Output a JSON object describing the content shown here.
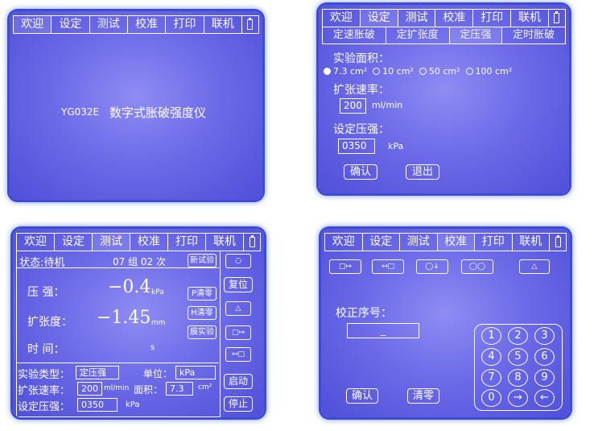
{
  "tabs": [
    "欢迎",
    "设定",
    "测试",
    "校准",
    "打印",
    "联机"
  ],
  "welcome": {
    "model": "YG032E",
    "title": "数字式胀破强度仪"
  },
  "settings": {
    "subtabs": [
      "定速胀破",
      "定扩张度",
      "定压强",
      "定时胀破"
    ],
    "area_label": "实验面积：",
    "areas": [
      "7.3 cm²",
      "10 cm²",
      "50 cm²",
      "100 cm²"
    ],
    "speed_label": "扩张速率：",
    "speed_value": "200",
    "speed_unit": "ml/min",
    "pressure_label": "设定压强：",
    "pressure_value": "0350",
    "pressure_unit": "kPa",
    "confirm": "确认",
    "exit": "退出"
  },
  "test": {
    "status": "状态:待机",
    "group": "07 组 02 次",
    "new_test": "新试验",
    "pressure_label": "压  强：",
    "pressure_value": "−0.4",
    "pressure_unit": "kPa",
    "expansion_label": "扩张度：",
    "expansion_value": "−1.45",
    "expansion_unit": "mm",
    "time_label": "时  间：",
    "time_value": "s",
    "clear_pressure": "P清零",
    "clear_h": "H清零",
    "mode_btn": "膜实验",
    "reset": "复位",
    "start": "启动",
    "stop": "停止",
    "type_label": "实验类型：",
    "type_value": "定压强",
    "unit_label": "单位：",
    "unit_value": "kPa",
    "speed_label": "扩张速率：",
    "speed_value": "200",
    "speed_unit": "ml/min",
    "area_label": "面积：",
    "area_value": "7.3",
    "area_unit": "cm²",
    "set_pressure_label": "设定压强：",
    "set_pressure_value": "0350",
    "set_pressure_unit": "kPa"
  },
  "calib": {
    "seq_label": "校正序号：",
    "seq_value": "_",
    "confirm": "确认",
    "clear": "清零",
    "keys": [
      "1",
      "2",
      "3",
      "4",
      "5",
      "6",
      "7",
      "8",
      "9",
      "0",
      "→",
      "←"
    ]
  }
}
